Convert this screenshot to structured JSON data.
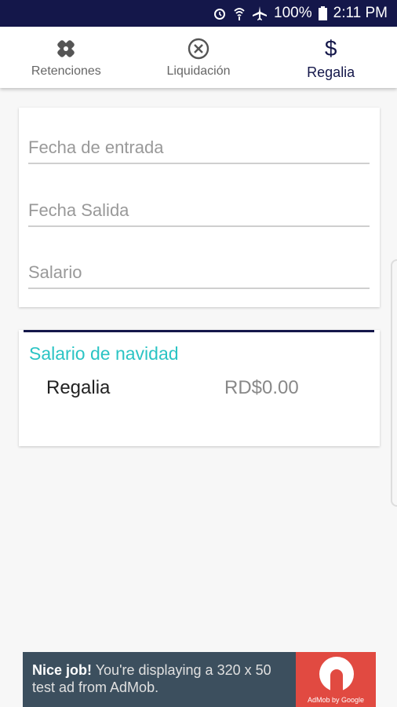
{
  "status_bar": {
    "battery": "100%",
    "time": "2:11 PM"
  },
  "tabs": [
    {
      "label": "Retenciones",
      "icon": "bandage-icon"
    },
    {
      "label": "Liquidación",
      "icon": "close-circle-icon"
    },
    {
      "label": "Regalia",
      "icon": "dollar-icon"
    }
  ],
  "form": {
    "fecha_entrada_placeholder": "Fecha de entrada",
    "fecha_salida_placeholder": "Fecha Salida",
    "salario_placeholder": "Salario"
  },
  "result": {
    "title": "Salario de navidad",
    "label": "Regalia",
    "value": "RD$0.00"
  },
  "ad": {
    "bold": "Nice job!",
    "text": " You're displaying a 320 x 50 test ad from AdMob.",
    "brand": "AdMob by Google"
  },
  "colors": {
    "primary": "#14174a",
    "accent": "#2bc4c4",
    "ad_bg": "#3c4f5e",
    "ad_logo": "#e14a41"
  }
}
